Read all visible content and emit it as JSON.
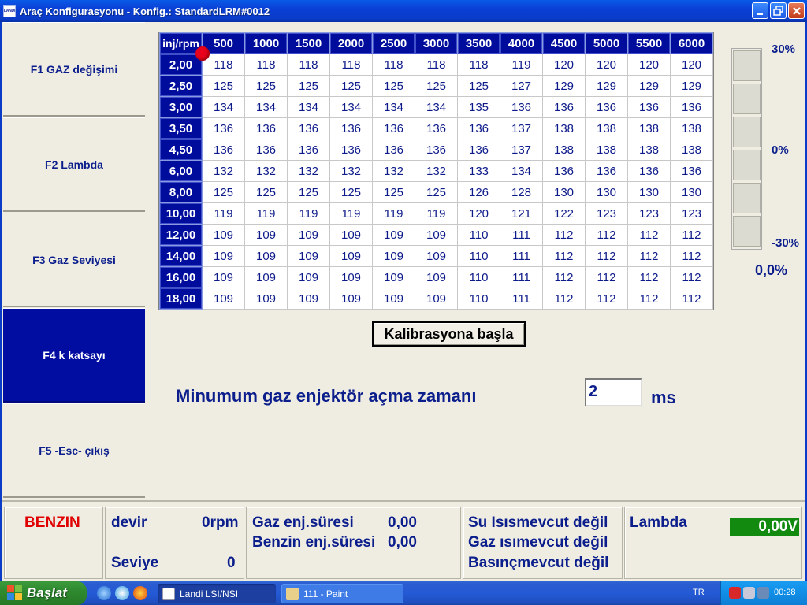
{
  "window": {
    "title": "Araç Konfigurasyonu - Konfig.: StandardLRM#0012",
    "app_icon_text": "LANDI"
  },
  "sidebar": {
    "items": [
      {
        "label": "F1 GAZ değişimi",
        "active": false
      },
      {
        "label": "F2 Lambda",
        "active": false
      },
      {
        "label": "F3 Gaz Seviyesi",
        "active": false
      },
      {
        "label": "F4 k katsayı",
        "active": true
      },
      {
        "label": "F5 -Esc- çıkış",
        "active": false
      }
    ]
  },
  "table": {
    "corner": "inj/rpm",
    "columns": [
      "500",
      "1000",
      "1500",
      "2000",
      "2500",
      "3000",
      "3500",
      "4000",
      "4500",
      "5000",
      "5500",
      "6000"
    ],
    "rows": [
      {
        "label": "2,00",
        "values": [
          118,
          118,
          118,
          118,
          118,
          118,
          118,
          119,
          120,
          120,
          120,
          120
        ]
      },
      {
        "label": "2,50",
        "values": [
          125,
          125,
          125,
          125,
          125,
          125,
          125,
          127,
          129,
          129,
          129,
          129
        ]
      },
      {
        "label": "3,00",
        "values": [
          134,
          134,
          134,
          134,
          134,
          134,
          135,
          136,
          136,
          136,
          136,
          136
        ]
      },
      {
        "label": "3,50",
        "values": [
          136,
          136,
          136,
          136,
          136,
          136,
          136,
          137,
          138,
          138,
          138,
          138
        ]
      },
      {
        "label": "4,50",
        "values": [
          136,
          136,
          136,
          136,
          136,
          136,
          136,
          137,
          138,
          138,
          138,
          138
        ]
      },
      {
        "label": "6,00",
        "values": [
          132,
          132,
          132,
          132,
          132,
          132,
          133,
          134,
          136,
          136,
          136,
          136
        ]
      },
      {
        "label": "8,00",
        "values": [
          125,
          125,
          125,
          125,
          125,
          125,
          126,
          128,
          130,
          130,
          130,
          130
        ]
      },
      {
        "label": "10,00",
        "values": [
          119,
          119,
          119,
          119,
          119,
          119,
          120,
          121,
          122,
          123,
          123,
          123
        ]
      },
      {
        "label": "12,00",
        "values": [
          109,
          109,
          109,
          109,
          109,
          109,
          110,
          111,
          112,
          112,
          112,
          112
        ]
      },
      {
        "label": "14,00",
        "values": [
          109,
          109,
          109,
          109,
          109,
          109,
          110,
          111,
          112,
          112,
          112,
          112
        ]
      },
      {
        "label": "16,00",
        "values": [
          109,
          109,
          109,
          109,
          109,
          109,
          110,
          111,
          112,
          112,
          112,
          112
        ]
      },
      {
        "label": "18,00",
        "values": [
          109,
          109,
          109,
          109,
          109,
          109,
          110,
          111,
          112,
          112,
          112,
          112
        ]
      }
    ]
  },
  "gauge": {
    "top_label": "30%",
    "mid_label": "0%",
    "bottom_label": "-30%",
    "value": "0,0%"
  },
  "calibrate": {
    "label_underlined": "K",
    "label_rest": "alibrasyona başla"
  },
  "min_injector": {
    "label": "Minumum gaz enjektör açma zamanı",
    "value": "2",
    "unit": "ms"
  },
  "status": {
    "mode": "BENZIN",
    "rpm_label": "devir",
    "rpm_value": "0rpm",
    "level_label": "Seviye",
    "level_value": "0",
    "gas_inj_label": "Gaz enj.süresi",
    "gas_inj_value": "0,00",
    "petrol_inj_label": "Benzin enj.süresi",
    "petrol_inj_value": "0,00",
    "water_temp": "Su Isısmevcut değil",
    "gas_temp": "Gaz ısımevcut değil",
    "pressure": "Basınçmevcut değil",
    "lambda_label": "Lambda",
    "lambda_value": "0,00V",
    "lambda_color": "#12890f"
  },
  "taskbar": {
    "start_label": "Başlat",
    "tasks": [
      {
        "label": "Landi LSI/NSI",
        "active": true
      },
      {
        "label": "111 - Paint",
        "active": false
      }
    ],
    "language": "TR",
    "clock": "00:28"
  }
}
